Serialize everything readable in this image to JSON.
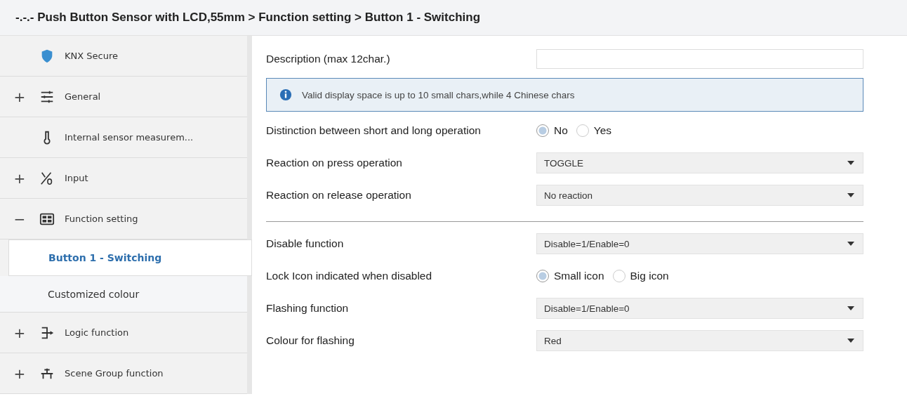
{
  "breadcrumb": "-.-.- Push Button Sensor with LCD,55mm > Function setting > Button 1 - Switching",
  "sidebar": {
    "items": [
      {
        "kind": "node",
        "label": "KNX Secure",
        "selected": false
      },
      {
        "kind": "node",
        "expander": "+",
        "label": "General",
        "selected": false
      },
      {
        "kind": "node",
        "label": "Internal sensor measurem...",
        "selected": false
      },
      {
        "kind": "node",
        "expander": "+",
        "label": "Input",
        "selected": false
      },
      {
        "kind": "node",
        "expander": "−",
        "label": "Function setting",
        "selected": false
      },
      {
        "kind": "sub",
        "label": "Button 1 - Switching",
        "selected": true
      },
      {
        "kind": "sub",
        "label": "Customized colour",
        "selected": false
      },
      {
        "kind": "node",
        "expander": "+",
        "label": "Logic function",
        "selected": false
      },
      {
        "kind": "node",
        "expander": "+",
        "label": "Scene Group function",
        "selected": false
      }
    ]
  },
  "params": [
    {
      "kind": "text",
      "label": "Description (max 12char.)"
    },
    {
      "kind": "info",
      "text": "Valid display space is up to 10 small chars,while 4 Chinese chars"
    },
    {
      "kind": "radio",
      "label": "Distinction between short and long operation",
      "options": [
        {
          "label": "No",
          "selected": true
        },
        {
          "label": "Yes",
          "selected": false
        }
      ]
    },
    {
      "kind": "select",
      "label": "Reaction on press operation",
      "value": "TOGGLE"
    },
    {
      "kind": "select",
      "label": "Reaction on release operation",
      "value": "No reaction"
    },
    {
      "kind": "separator"
    },
    {
      "kind": "select",
      "label": "Disable function",
      "value": "Disable=1/Enable=0"
    },
    {
      "kind": "radio",
      "label": "Lock Icon indicated when disabled",
      "options": [
        {
          "label": "Small icon",
          "selected": true
        },
        {
          "label": "Big icon",
          "selected": false
        }
      ]
    },
    {
      "kind": "select",
      "label": "Flashing function",
      "value": "Disable=1/Enable=0"
    },
    {
      "kind": "select",
      "label": "Colour for flashing",
      "value": "Red"
    }
  ]
}
